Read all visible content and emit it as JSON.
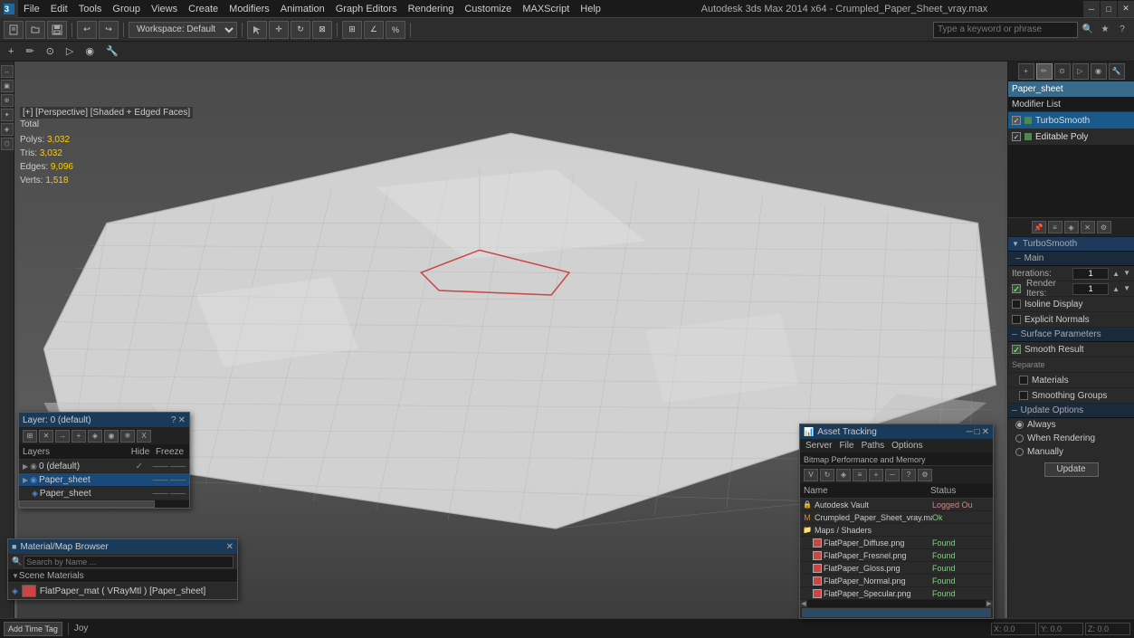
{
  "app": {
    "title": "Autodesk 3ds Max 2014 x64",
    "file": "Crumpled_Paper_Sheet_vray.max",
    "workspace": "Workspace: Default"
  },
  "menubar": {
    "items": [
      "File",
      "Edit",
      "Tools",
      "Group",
      "Views",
      "Create",
      "Modifiers",
      "Animation",
      "Graph Editors",
      "Rendering",
      "Customize",
      "MAXScript",
      "Help"
    ]
  },
  "viewport": {
    "label": "[+] [Perspective] [Shaded + Edged Faces]",
    "stats": {
      "total_label": "Total",
      "polys_label": "Polys:",
      "polys_val": "3,032",
      "tris_label": "Tris:",
      "tris_val": "3,032",
      "edges_label": "Edges:",
      "edges_val": "9,096",
      "verts_label": "Verts:",
      "verts_val": "1,518"
    }
  },
  "right_panel": {
    "object_name": "Paper_sheet",
    "modifier_list_label": "Modifier List",
    "modifiers": [
      {
        "name": "TurboSmooth",
        "enabled": true
      },
      {
        "name": "Editable Poly",
        "enabled": true
      }
    ],
    "turbosmooth": {
      "header": "TurboSmooth",
      "main_label": "Main",
      "iterations_label": "Iterations:",
      "iterations_val": "1",
      "render_iters_label": "Render Iters:",
      "render_iters_val": "1",
      "render_iters_checked": true,
      "isoline_display": "Isoline Display",
      "explicit_normals": "Explicit Normals",
      "surface_params_label": "Surface Parameters",
      "smooth_result": "Smooth Result",
      "smooth_result_checked": true,
      "separate_label": "Separate",
      "materials": "Materials",
      "smoothing_groups": "Smoothing Groups",
      "update_options_label": "Update Options",
      "always": "Always",
      "when_rendering": "When Rendering",
      "manually": "Manually",
      "update_btn": "Update"
    }
  },
  "layer_panel": {
    "title": "Layer: 0 (default)",
    "layers_col": "Layers",
    "hide_col": "Hide",
    "freeze_col": "Freeze",
    "items": [
      {
        "name": "0 (default)",
        "indent": false,
        "selected": false,
        "checked": true,
        "lines": "---   ---"
      },
      {
        "name": "Paper_sheet",
        "indent": false,
        "selected": true,
        "checked": false,
        "lines": "---   ---"
      },
      {
        "name": "Paper_sheet",
        "indent": true,
        "selected": false,
        "checked": false,
        "lines": "---   ---"
      }
    ]
  },
  "material_panel": {
    "title": "Material/Map Browser",
    "search_placeholder": "Search by Name ...",
    "scene_materials_label": "Scene Materials",
    "items": [
      {
        "name": "FlatPaper_mat ( VRayMtl ) [Paper_sheet]",
        "has_red": true
      }
    ]
  },
  "asset_panel": {
    "title": "Asset Tracking",
    "menu_items": [
      "Server",
      "File",
      "Paths",
      "Options"
    ],
    "bitmap_label": "Bitmap Performance and Memory",
    "name_col": "Name",
    "status_col": "Status",
    "items": [
      {
        "name": "Autodesk Vault",
        "status": "Logged Ou",
        "indent": false,
        "type": "vault"
      },
      {
        "name": "Crumpled_Paper_Sheet_vray.max",
        "status": "Ok",
        "indent": false,
        "type": "max"
      },
      {
        "name": "Maps / Shaders",
        "status": "",
        "indent": false,
        "type": "folder"
      },
      {
        "name": "FlatPaper_Diffuse.png",
        "status": "Found",
        "indent": true,
        "type": "img"
      },
      {
        "name": "FlatPaper_Fresnel.png",
        "status": "Found",
        "indent": true,
        "type": "img"
      },
      {
        "name": "FlatPaper_Gloss.png",
        "status": "Found",
        "indent": true,
        "type": "img"
      },
      {
        "name": "FlatPaper_Normal.png",
        "status": "Found",
        "indent": true,
        "type": "img"
      },
      {
        "name": "FlatPaper_Specular.png",
        "status": "Found",
        "indent": true,
        "type": "img"
      }
    ]
  },
  "status_bar": {
    "add_time_tag_label": "Add Time Tag",
    "coords": {
      "x": "",
      "y": "",
      "z": ""
    }
  },
  "icons": {
    "close": "✕",
    "minimize": "─",
    "maximize": "□",
    "triangle_down": "▼",
    "triangle_right": "▶",
    "check": "✓",
    "dot": "●"
  }
}
